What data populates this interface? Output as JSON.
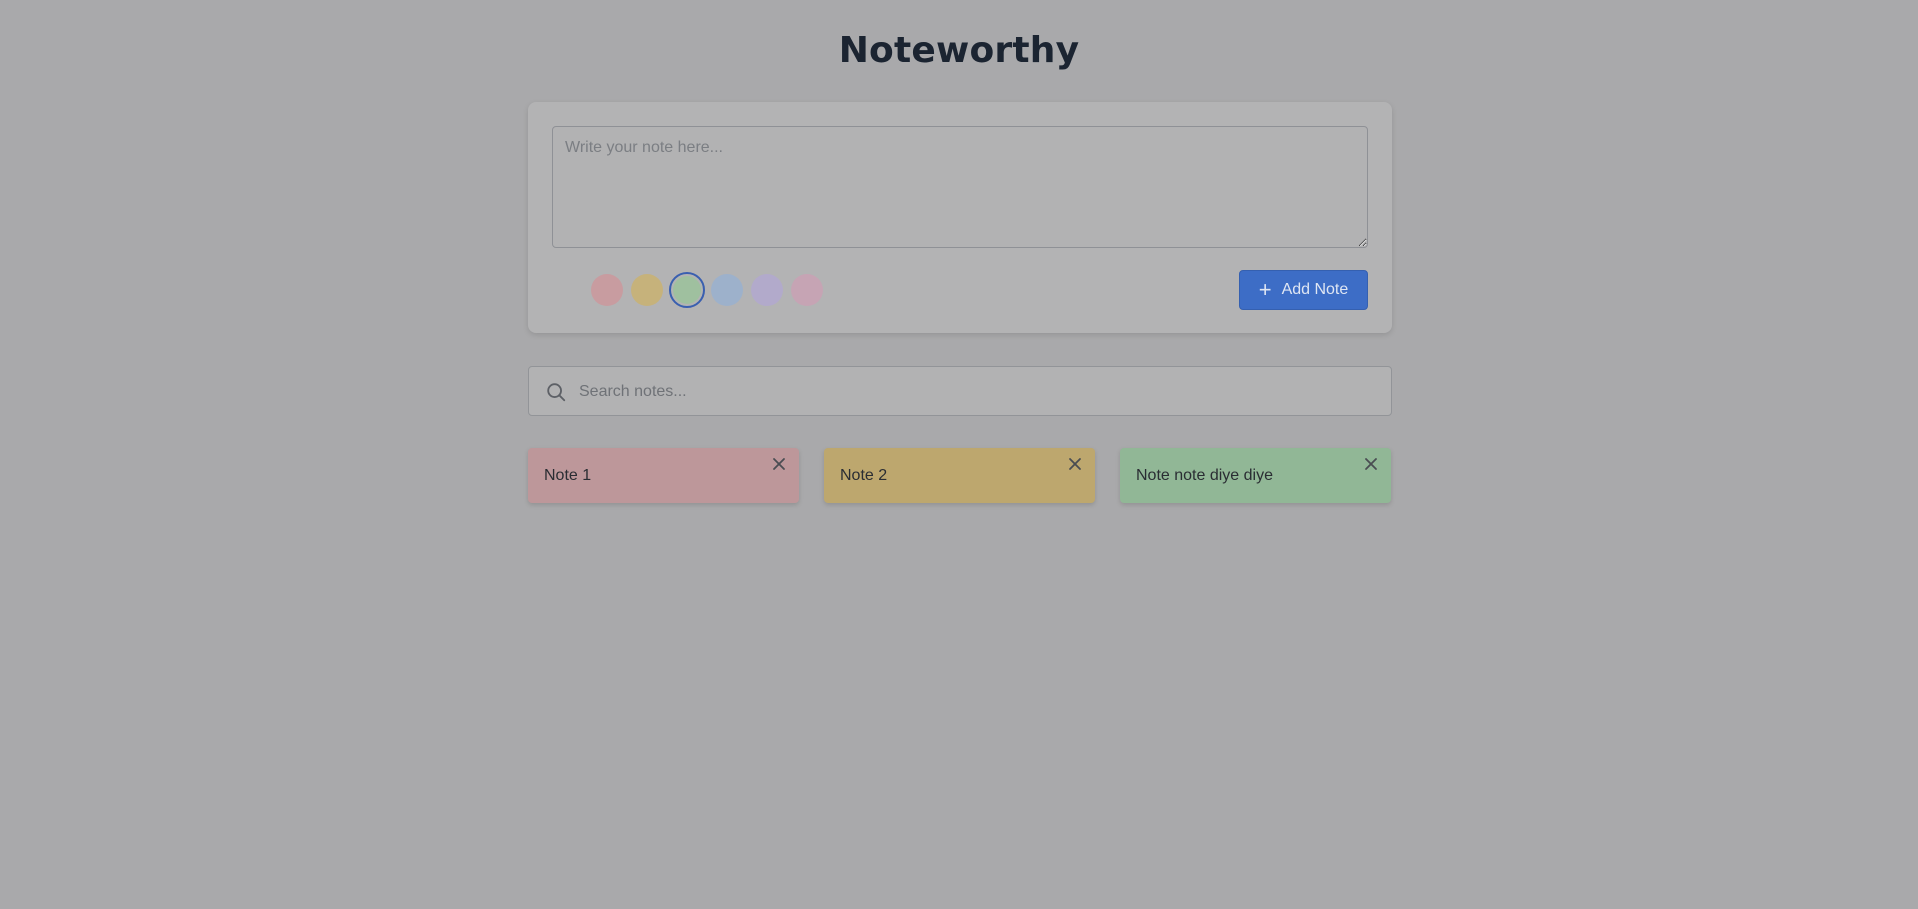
{
  "app": {
    "title": "Noteworthy"
  },
  "composer": {
    "placeholder": "Write your note here...",
    "colors": [
      {
        "name": "red",
        "hex": "#c89ca0"
      },
      {
        "name": "yellow",
        "hex": "#c6b27b"
      },
      {
        "name": "green",
        "hex": "#9fc09f",
        "selected": true
      },
      {
        "name": "blue",
        "hex": "#9db1cb"
      },
      {
        "name": "purple",
        "hex": "#b2aacb"
      },
      {
        "name": "pink",
        "hex": "#c6a4b4"
      }
    ],
    "add_label": "Add Note",
    "add_icon": "plus-icon"
  },
  "search": {
    "placeholder": "Search notes...",
    "icon": "search-icon"
  },
  "notes": [
    {
      "text": "Note 1",
      "color": "#bd979a"
    },
    {
      "text": "Note 2",
      "color": "#bda76e"
    },
    {
      "text": "Note note diye diye",
      "color": "#91b796"
    }
  ],
  "theme": {
    "background": "#a9a9ab",
    "accent": "#3d6dc6"
  }
}
